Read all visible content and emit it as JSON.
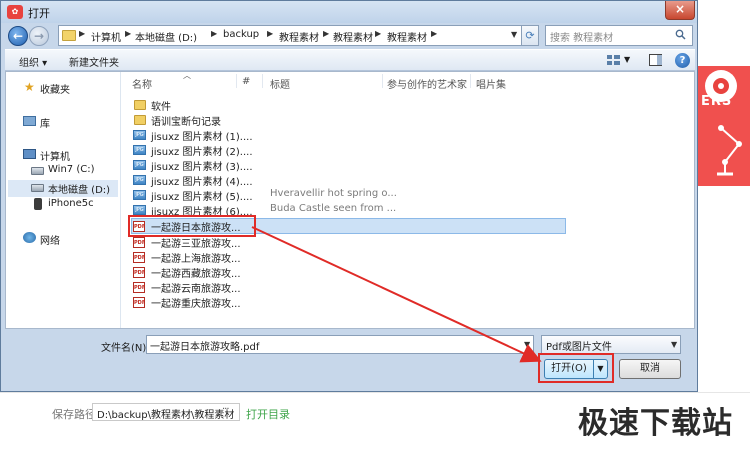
{
  "dialog": {
    "title": "打开",
    "close_label": "×",
    "address": {
      "segments": [
        "计算机",
        "本地磁盘 (D:)",
        "backup",
        "教程素材",
        "教程素材",
        "教程素材"
      ]
    },
    "search_placeholder": "搜索 教程素材",
    "toolbar": {
      "organize": "组织 ▾",
      "new_folder": "新建文件夹"
    },
    "nav": {
      "favorites": "收藏夹",
      "libraries": "库",
      "computer": "计算机",
      "drive_c": "Win7 (C:)",
      "drive_d": "本地磁盘 (D:)",
      "phone": "iPhone5c",
      "network": "网络"
    },
    "columns": {
      "name": "名称",
      "number": "#",
      "title": "标题",
      "artist": "参与创作的艺术家",
      "album": "唱片集"
    },
    "files": [
      {
        "name": "软件",
        "kind": "folder",
        "title": ""
      },
      {
        "name": "语训宝断句记录",
        "kind": "folder",
        "title": ""
      },
      {
        "name": "jisuxz 图片素材 (1)....",
        "kind": "jpg",
        "title": ""
      },
      {
        "name": "jisuxz 图片素材 (2)....",
        "kind": "jpg",
        "title": ""
      },
      {
        "name": "jisuxz 图片素材 (3)....",
        "kind": "jpg",
        "title": ""
      },
      {
        "name": "jisuxz 图片素材 (4)....",
        "kind": "jpg",
        "title": ""
      },
      {
        "name": "jisuxz 图片素材 (5)....",
        "kind": "jpg",
        "title": "Hveravellir hot spring o..."
      },
      {
        "name": "jisuxz 图片素材 (6)....",
        "kind": "jpg",
        "title": "Buda Castle seen from ..."
      },
      {
        "name": "一起游日本旅游攻...",
        "kind": "pdf",
        "title": ""
      },
      {
        "name": "一起游三亚旅游攻...",
        "kind": "pdf",
        "title": ""
      },
      {
        "name": "一起游上海旅游攻...",
        "kind": "pdf",
        "title": ""
      },
      {
        "name": "一起游西藏旅游攻...",
        "kind": "pdf",
        "title": ""
      },
      {
        "name": "一起游云南旅游攻...",
        "kind": "pdf",
        "title": ""
      },
      {
        "name": "一起游重庆旅游攻...",
        "kind": "pdf",
        "title": ""
      }
    ],
    "filename_label": "文件名(N):",
    "filename_value": "一起游日本旅游攻略.pdf",
    "filetype_value": "Pdf或图片文件",
    "open_button": "打开(O)",
    "cancel_button": "取消"
  },
  "background": {
    "promo_text": "ERS",
    "save_path_label": "保存路径:",
    "save_path_value": "D:\\backup\\教程素材\\教程素材",
    "save_path_more": "···",
    "open_dir_link": "打开目录",
    "watermark": "极速下载站"
  },
  "colors": {
    "annotation_red": "#e02b27",
    "link_green": "#3fa54a",
    "promo_red": "#f0504e"
  }
}
